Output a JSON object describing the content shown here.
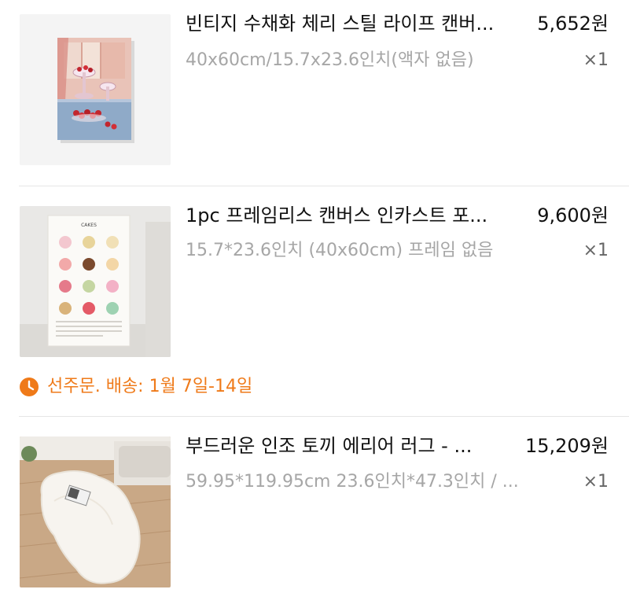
{
  "items": [
    {
      "title": "빈티지 수채화 체리 스틸 라이프 캔버...",
      "price": "5,652원",
      "option": "40x60cm/15.7x23.6인치(액자 없음)",
      "quantity": "×1",
      "thumbnail_icon": "cherry-still-life-painting"
    },
    {
      "title": "1pc 프레임리스 캔버스 인카스트 포...",
      "price": "9,600원",
      "option": "15.7*23.6인치 (40x60cm) 프레임 없음",
      "quantity": "×1",
      "thumbnail_icon": "cakes-poster",
      "poster_heading": "CAKES",
      "notice": {
        "text": "선주문. 배송: 1월 7일-14일",
        "icon": "clock-icon",
        "color": "#EF7A19"
      }
    },
    {
      "title": "부드러운 인조 토끼 에리어 러그 - ...",
      "price": "15,209원",
      "option": "59.95*119.95cm 23.6인치*47.3인치 / ...",
      "quantity": "×1",
      "thumbnail_icon": "fluffy-white-rug"
    }
  ]
}
